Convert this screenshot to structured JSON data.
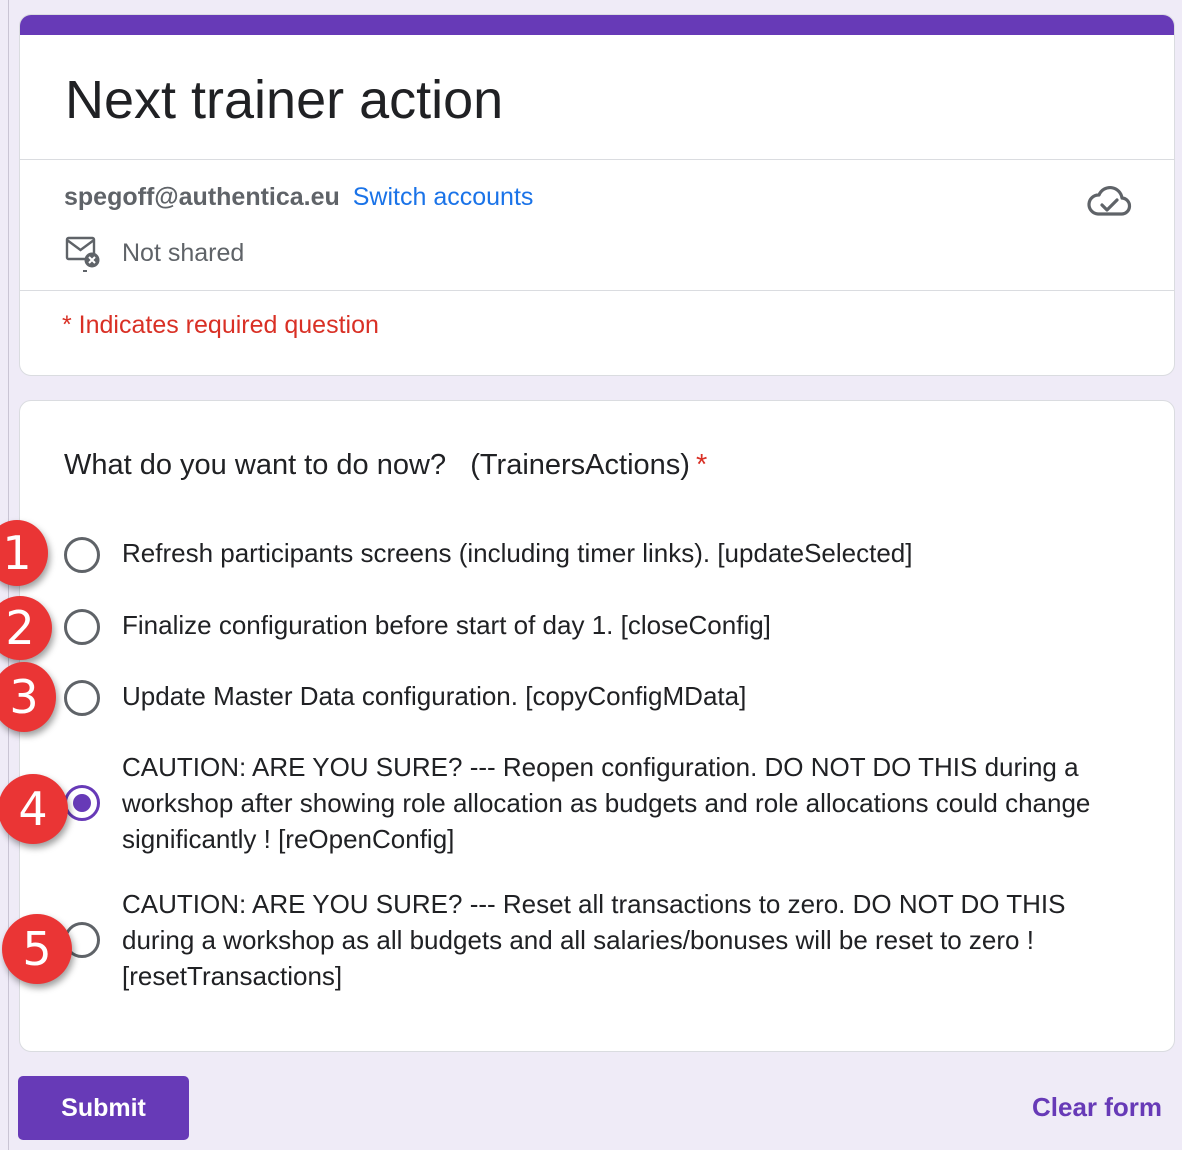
{
  "form": {
    "title": "Next trainer action",
    "accent_color": "#673ab7"
  },
  "account": {
    "email": "spegoff@authentica.eu",
    "switch_label": "Switch accounts",
    "shared_status": "Not shared",
    "saved_icon": "cloud-check-icon",
    "shared_icon": "mail-off-icon"
  },
  "required_note": "* Indicates required question",
  "question": {
    "title": "What do you want to do now?   (TrainersActions)",
    "required_mark": "*",
    "options": [
      {
        "label": "Refresh participants screens (including timer links).   [updateSelected]",
        "selected": false
      },
      {
        "label": "Finalize configuration before start of day 1.   [closeConfig]",
        "selected": false
      },
      {
        "label": "Update Master Data configuration.   [copyConfigMData]",
        "selected": false
      },
      {
        "label": "CAUTION: ARE YOU SURE? --- Reopen configuration. DO NOT DO THIS during a workshop after showing role allocation as budgets and role allocations could change significantly !  [reOpenConfig]",
        "selected": true
      },
      {
        "label": "CAUTION: ARE YOU SURE? --- Reset all transactions to zero.  DO NOT DO THIS during a workshop as all budgets and all salaries/bonuses will be reset to zero !  [resetTransactions]",
        "selected": false
      }
    ]
  },
  "badges": [
    "1",
    "2",
    "3",
    "4",
    "5"
  ],
  "actions": {
    "submit_label": "Submit",
    "clear_label": "Clear form"
  }
}
